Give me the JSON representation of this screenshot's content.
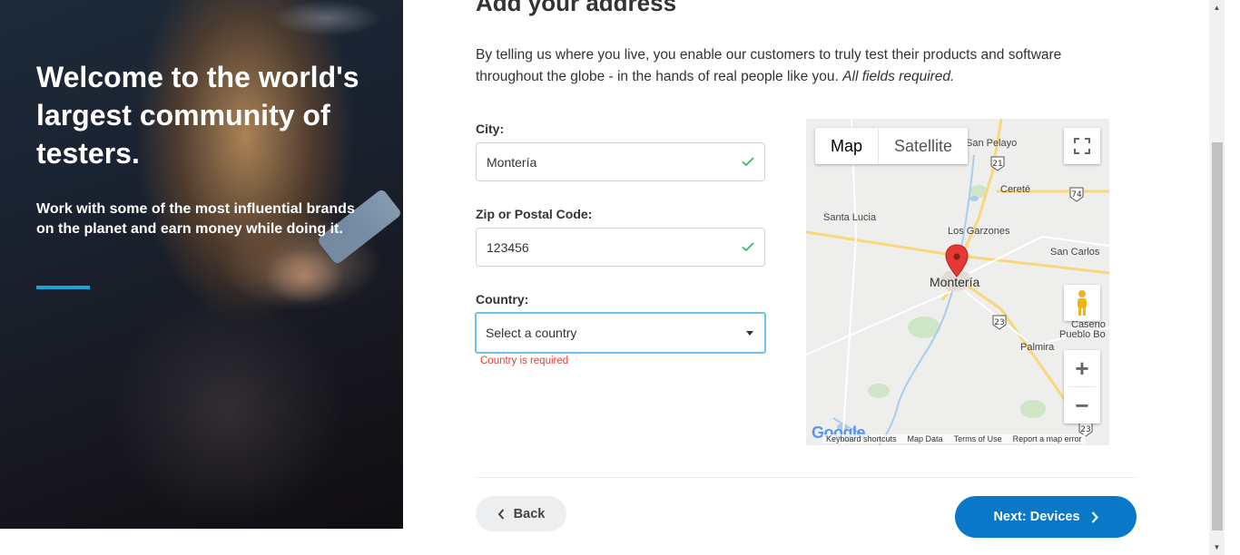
{
  "hero": {
    "title": "Welcome to the world's largest community of testers.",
    "subtitle": "Work with some of the most influential brands on the planet and earn money while doing it.",
    "accent_color": "#1aa3d6"
  },
  "address": {
    "title": "Add your address",
    "intro": "By telling us where you live, you enable our customers to truly test their products and software throughout the globe - in the hands of real people like you.",
    "intro_emphasis": "All fields required."
  },
  "form": {
    "city": {
      "label": "City:",
      "value": "Montería",
      "valid_icon": "check-icon"
    },
    "zip": {
      "label": "Zip or Postal Code:",
      "value": "123456",
      "valid_icon": "check-icon"
    },
    "country": {
      "label": "Country:",
      "placeholder": "Select a country",
      "error": "Country is required"
    }
  },
  "map": {
    "type_map": "Map",
    "type_satellite": "Satellite",
    "center_label": "Montería",
    "places": [
      "San Pelayo",
      "Cereté",
      "Santa Lucia",
      "Los Garzones",
      "San Carlos",
      "Caserio",
      "Pueblo Bo",
      "Palmira"
    ],
    "route_shields": [
      "21",
      "74",
      "23",
      "23"
    ],
    "footer": [
      "Keyboard shortcuts",
      "Map Data",
      "Terms of Use",
      "Report a map error"
    ],
    "logo": "Google",
    "zoom_in": "+",
    "zoom_out": "−"
  },
  "nav": {
    "back": "Back",
    "next": "Next: Devices",
    "next_color": "#0a78c8"
  }
}
